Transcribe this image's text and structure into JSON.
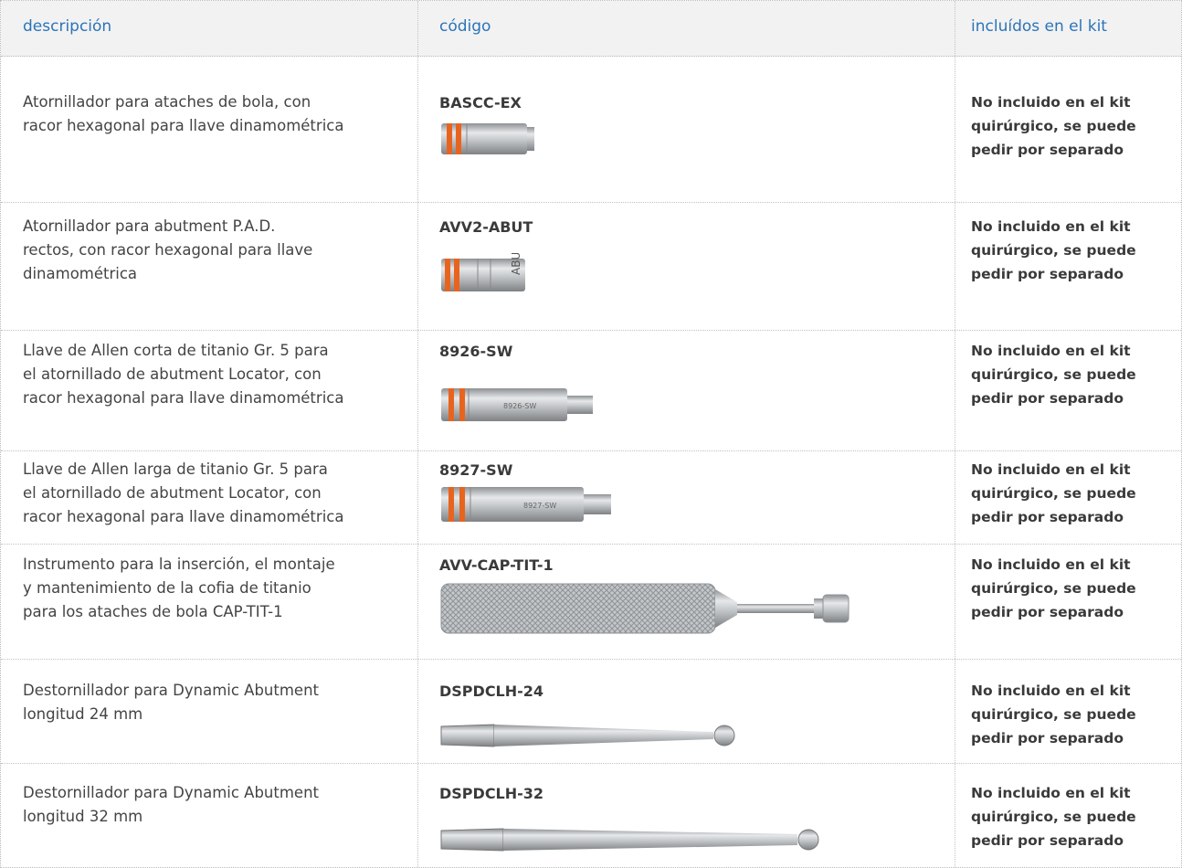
{
  "header": {
    "col1": "descripción",
    "col2": "código",
    "col3": "incluídos en el kit"
  },
  "rows": [
    {
      "desc_lines": [
        "Atornillador para ataches de bola, con",
        "racor hexagonal para llave dinamométrica"
      ],
      "code": "BASCC-EX",
      "included_lines": [
        "No incluido en el kit",
        "quirúrgico, se puede",
        "pedir por separado"
      ],
      "tool_icon": "hex-driver-short-icon"
    },
    {
      "desc_lines": [
        "Atornillador para abutment P.A.D.",
        "rectos, con racor hexagonal para llave",
        "dinamométrica"
      ],
      "code": "AVV2-ABUT",
      "included_lines": [
        "No incluido en el kit",
        "quirúrgico, se puede",
        "pedir por separado"
      ],
      "tool_icon": "abutment-driver-icon",
      "tool_text": "ABUT"
    },
    {
      "desc_lines": [
        "Llave de Allen corta de titanio Gr. 5 para",
        "el atornillado de abutment Locator, con",
        "racor hexagonal para llave dinamométrica"
      ],
      "code": "8926-SW",
      "included_lines": [
        "No incluido en el kit",
        "quirúrgico, se puede",
        "pedir por separado"
      ],
      "tool_icon": "allen-key-short-icon",
      "tool_text": "8926-SW"
    },
    {
      "desc_lines": [
        "Llave de Allen larga de titanio Gr. 5 para",
        "el atornillado de abutment Locator, con",
        "racor hexagonal para llave dinamométrica"
      ],
      "code": "8927-SW",
      "included_lines": [
        "No incluido en el kit",
        "quirúrgico, se puede",
        "pedir por separado"
      ],
      "tool_icon": "allen-key-long-icon",
      "tool_text": "8927-SW"
    },
    {
      "desc_lines": [
        "Instrumento para la inserción, el montaje",
        "y mantenimiento de la cofia de titanio",
        "para los ataches de bola CAP-TIT-1"
      ],
      "code": "AVV-CAP-TIT-1",
      "included_lines": [
        "No incluido en el kit",
        "quirúrgico, se puede",
        "pedir por separado"
      ],
      "tool_icon": "knurled-handle-instrument-icon"
    },
    {
      "desc_lines": [
        "Destornillador para Dynamic Abutment",
        "longitud 24 mm"
      ],
      "code": "DSPDCLH-24",
      "included_lines": [
        "No incluido en el kit",
        "quirúrgico, se puede",
        "pedir por separado"
      ],
      "tool_icon": "ball-screwdriver-short-icon"
    },
    {
      "desc_lines": [
        "Destornillador para Dynamic Abutment",
        "longitud 32 mm"
      ],
      "code": "DSPDCLH-32",
      "included_lines": [
        "No incluido en el kit",
        "quirúrgico, se puede",
        "pedir por separado"
      ],
      "tool_icon": "ball-screwdriver-long-icon"
    }
  ],
  "colors": {
    "header_text": "#2b74b8",
    "header_bg": "#f2f2f2",
    "orange_ring": "#e8641e",
    "metal": "#b9bcbf"
  }
}
